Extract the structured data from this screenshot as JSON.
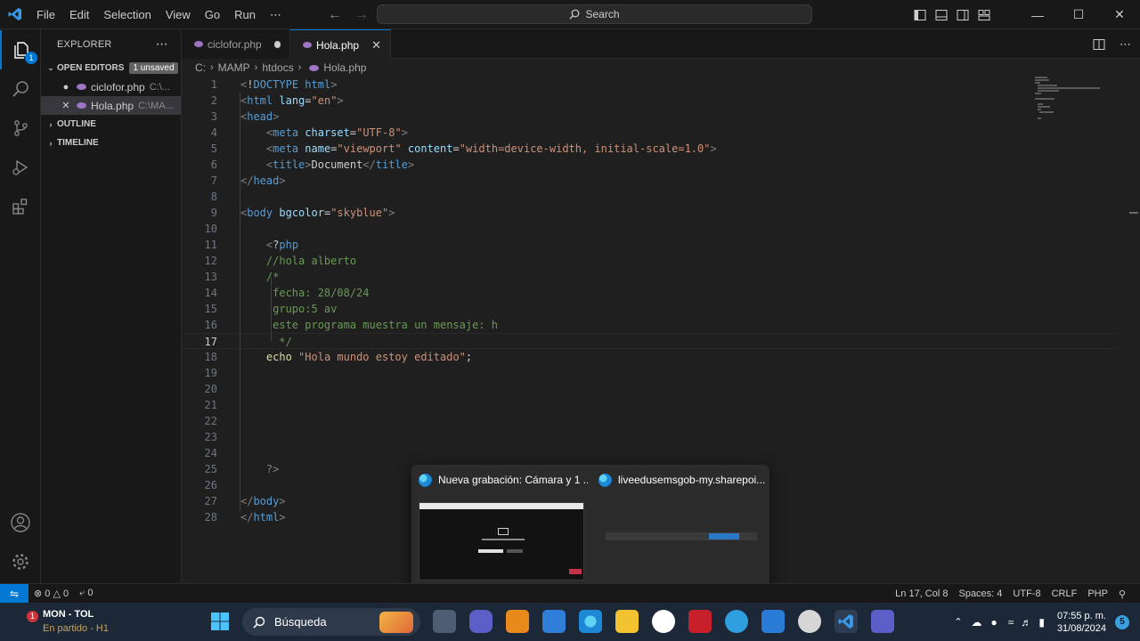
{
  "titlebar": {
    "menu": [
      "File",
      "Edit",
      "Selection",
      "View",
      "Go",
      "Run",
      "⋯"
    ],
    "search_placeholder": "Search"
  },
  "explorer": {
    "title": "EXPLORER",
    "open_editors_label": "OPEN EDITORS",
    "unsaved_badge": "1 unsaved",
    "open_files": [
      {
        "name": "ciclofor.php",
        "path": "C:\\...",
        "dirty": true
      },
      {
        "name": "Hola.php",
        "path": "C:\\MA...",
        "dirty": false
      }
    ],
    "outline_label": "OUTLINE",
    "timeline_label": "TIMELINE"
  },
  "tabs": [
    {
      "label": "ciclofor.php",
      "active": false,
      "dirty": true
    },
    {
      "label": "Hola.php",
      "active": true,
      "dirty": false
    }
  ],
  "breadcrumb": [
    "C:",
    "MAMP",
    "htdocs",
    "Hola.php"
  ],
  "editor": {
    "current_line": 17,
    "lines": [
      {
        "n": "1",
        "t": "<!DOCTYPE html>"
      },
      {
        "n": "2",
        "t": "<html lang=\"en\">"
      },
      {
        "n": "3",
        "t": "<head>"
      },
      {
        "n": "4",
        "t": "    <meta charset=\"UTF-8\">"
      },
      {
        "n": "5",
        "t": "    <meta name=\"viewport\" content=\"width=device-width, initial-scale=1.0\">"
      },
      {
        "n": "6",
        "t": "    <title>Document</title>"
      },
      {
        "n": "7",
        "t": "</head>"
      },
      {
        "n": "8",
        "t": ""
      },
      {
        "n": "9",
        "t": "<body bgcolor=\"skyblue\">"
      },
      {
        "n": "10",
        "t": ""
      },
      {
        "n": "11",
        "t": "    <?php"
      },
      {
        "n": "12",
        "t": "    //hola alberto"
      },
      {
        "n": "13",
        "t": "    /*"
      },
      {
        "n": "14",
        "t": "     fecha: 28/08/24"
      },
      {
        "n": "15",
        "t": "     grupo:5 av"
      },
      {
        "n": "16",
        "t": "     este programa muestra un mensaje: h"
      },
      {
        "n": "17",
        "t": "      */"
      },
      {
        "n": "18",
        "t": "    echo \"Hola mundo estoy editado\";"
      },
      {
        "n": "19",
        "t": ""
      },
      {
        "n": "20",
        "t": ""
      },
      {
        "n": "21",
        "t": ""
      },
      {
        "n": "22",
        "t": ""
      },
      {
        "n": "23",
        "t": ""
      },
      {
        "n": "24",
        "t": ""
      },
      {
        "n": "25",
        "t": "    ?>"
      },
      {
        "n": "26",
        "t": ""
      },
      {
        "n": "27",
        "t": "</body>"
      },
      {
        "n": "28",
        "t": "</html>"
      }
    ]
  },
  "thumbnails": [
    {
      "title": "Nueva grabación: Cámara y 1 ..."
    },
    {
      "title": "liveedusemsgob-my.sharepoi..."
    }
  ],
  "statusbar": {
    "problems": "0",
    "warnings": "0",
    "ports": "0",
    "position": "Ln 17, Col 8",
    "spaces": "Spaces: 4",
    "encoding": "UTF-8",
    "eol": "CRLF",
    "language": "PHP"
  },
  "taskbar": {
    "weather_title": "MON - TOL",
    "weather_sub": "En partido - H1",
    "weather_badge": "1",
    "search_label": "Búsqueda",
    "time": "07:55 p. m.",
    "date": "31/08/2024",
    "notifications": "5"
  },
  "colors": {
    "accent": "#0078d4",
    "tag": "#808080",
    "attr": "#9cdcfe",
    "string": "#ce9178",
    "comment": "#6a9955",
    "text": "#cccccc"
  }
}
